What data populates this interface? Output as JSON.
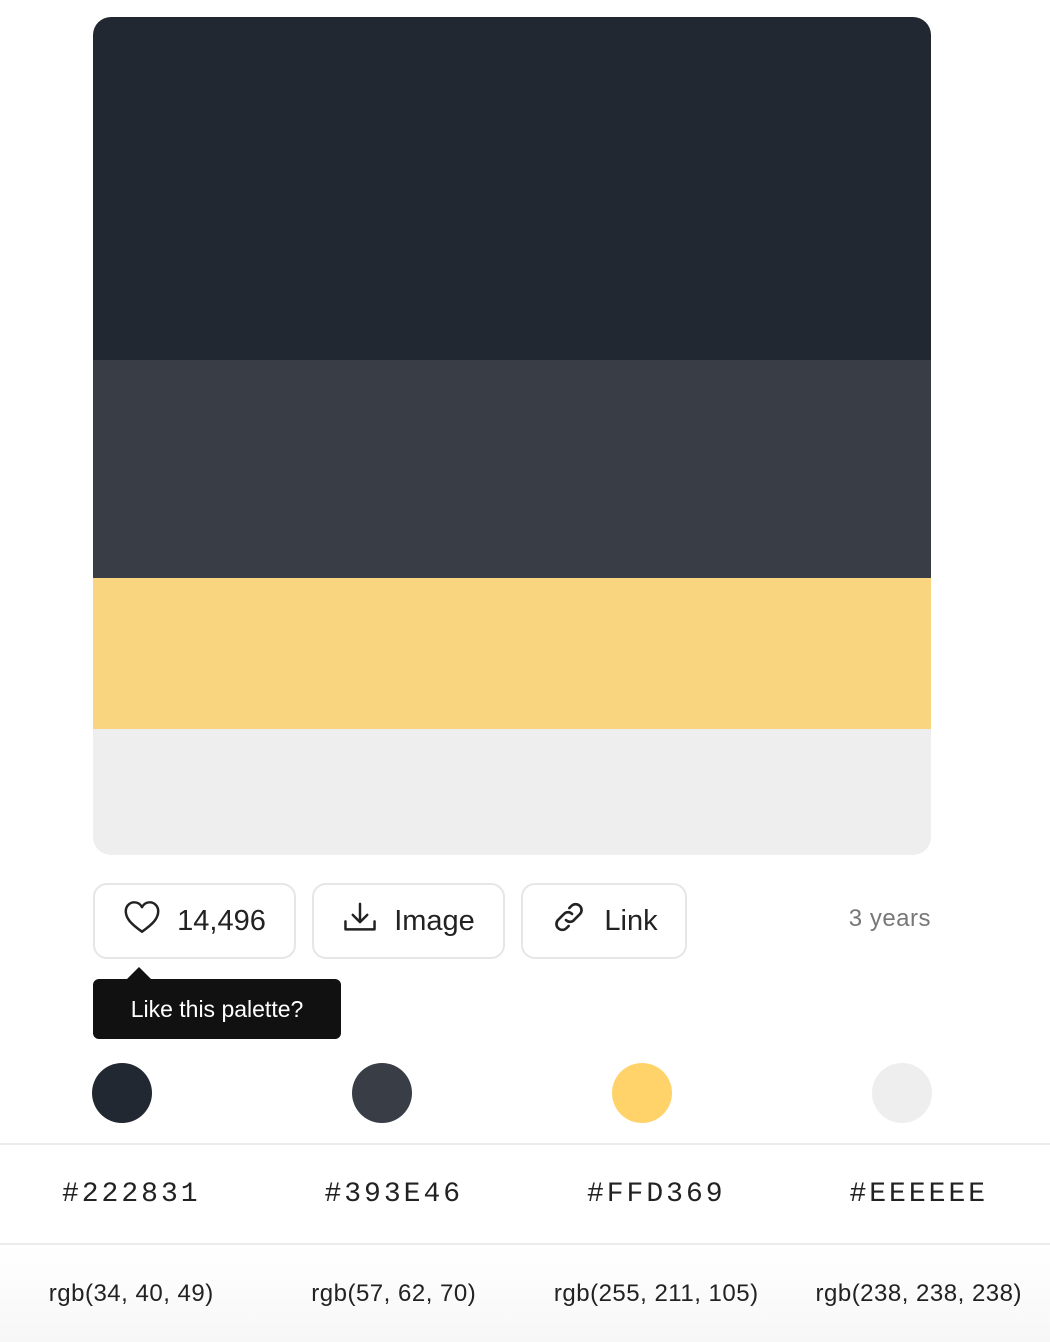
{
  "palette": {
    "colors": [
      {
        "hex": "#222831",
        "rgb": "rgb(34, 40, 49)"
      },
      {
        "hex": "#393E46",
        "rgb": "rgb(57, 62, 70)"
      },
      {
        "hex": "#FFD369",
        "rgb": "rgb(255, 211, 105)"
      },
      {
        "hex": "#EEEEEE",
        "rgb": "rgb(238, 238, 238)"
      }
    ],
    "stripe_colors": [
      "#222831",
      "#393E46",
      "#F8D57E",
      "#EEEEEE"
    ]
  },
  "actions": {
    "like_count": "14,496",
    "image_label": "Image",
    "link_label": "Link",
    "age": "3 years"
  },
  "tooltip": {
    "text": "Like this palette?"
  },
  "icons": {
    "like": "heart-icon",
    "image": "download-icon",
    "link": "link-icon"
  }
}
